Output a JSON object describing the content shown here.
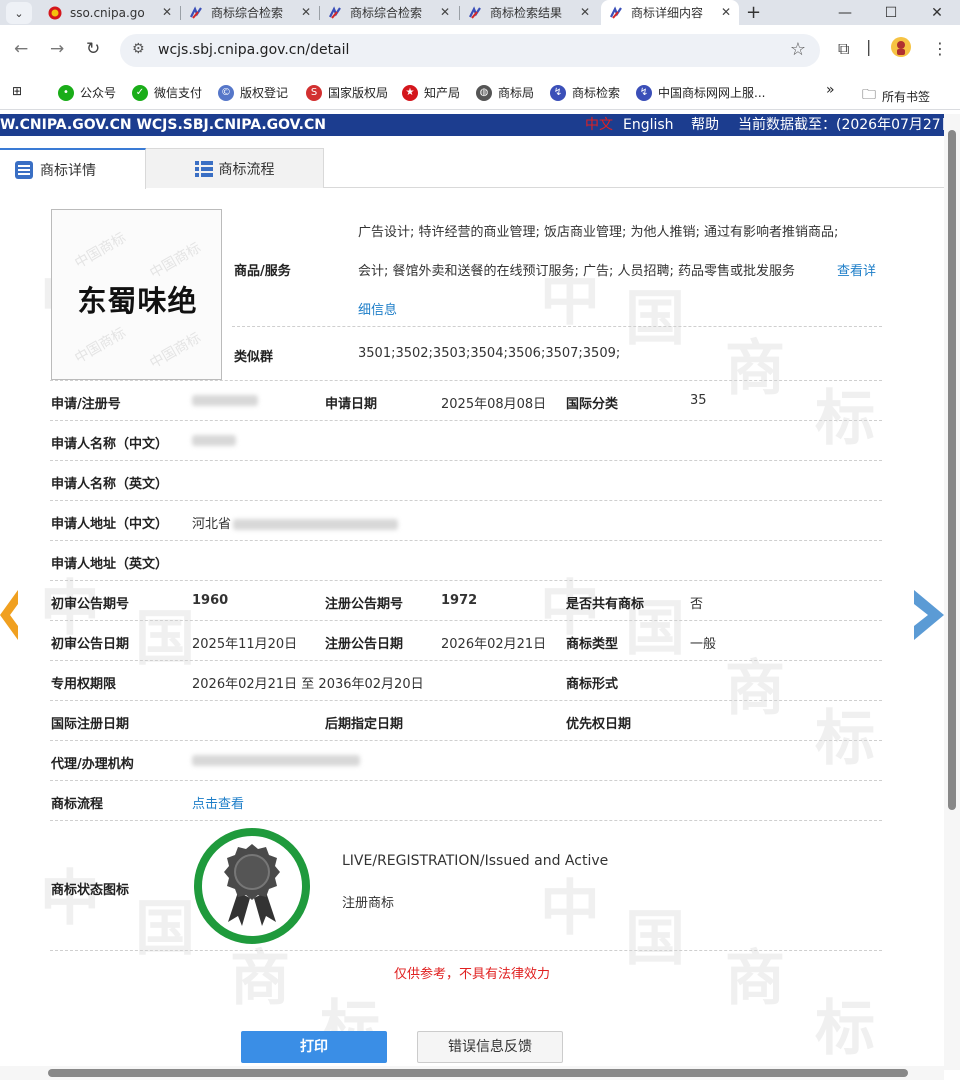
{
  "browser": {
    "tabs": [
      {
        "title": "sso.cnipa.go",
        "icon": "cnipa-emblem-icon"
      },
      {
        "title": "商标综合检索",
        "icon": "trademark-bureau-icon"
      },
      {
        "title": "商标综合检索",
        "icon": "trademark-bureau-icon"
      },
      {
        "title": "商标检索结果",
        "icon": "trademark-bureau-icon"
      },
      {
        "title": "商标详细内容",
        "icon": "trademark-bureau-icon",
        "active": true
      }
    ],
    "url": "wcjs.sbj.cnipa.gov.cn/detail",
    "bookmarks": [
      "公众号",
      "微信支付",
      "版权登记",
      "国家版权局",
      "知产局",
      "商标局",
      "商标检索",
      "中国商标网网上服..."
    ],
    "all_bookmarks": "所有书签",
    "overflow_glyph": "»"
  },
  "site_bar": {
    "site": "W.CNIPA.GOV.CN WCJS.SBJ.CNIPA.GOV.CN",
    "lang_cn": "中文",
    "lang_en": "English",
    "help": "帮助",
    "data_as_of": "当前数据截至：(2026年07月27日"
  },
  "page_tabs": {
    "detail": "商标详情",
    "flow": "商标流程"
  },
  "trademark": {
    "mark_text": "东蜀味绝",
    "goods_label": "商品/服务",
    "goods_lines": [
      "广告设计; 特许经营的商业管理; 饭店商业管理; 为他人推销; 通过有影响者推销商品;",
      "会计; 餐馆外卖和送餐的在线预订服务; 广告; 人员招聘; 药品零售或批发服务"
    ],
    "view_more": "查看详",
    "view_more_cont": "细信息",
    "similar_label": "类似群",
    "similar_value": "3501;3502;3503;3504;3506;3507;3509;"
  },
  "fields": {
    "reg_no_label": "申请/注册号",
    "app_date_label": "申请日期",
    "app_date": "2025年08月08日",
    "intl_class_label": "国际分类",
    "intl_class": "35",
    "applicant_cn_label": "申请人名称（中文）",
    "applicant_en_label": "申请人名称（英文）",
    "address_cn_label": "申请人地址（中文）",
    "address_cn_prefix": "河北省",
    "address_en_label": "申请人地址（英文）",
    "prelim_issue_label": "初审公告期号",
    "prelim_issue": "1960",
    "reg_issue_label": "注册公告期号",
    "reg_issue": "1972",
    "shared_label": "是否共有商标",
    "shared": "否",
    "prelim_date_label": "初审公告日期",
    "prelim_date": "2025年11月20日",
    "reg_date_label": "注册公告日期",
    "reg_date": "2026年02月21日",
    "type_label": "商标类型",
    "type": "一般",
    "term_label": "专用权期限",
    "term": "2026年02月21日 至 2036年02月20日",
    "form_label": "商标形式",
    "intl_reg_date_label": "国际注册日期",
    "later_date_label": "后期指定日期",
    "priority_date_label": "优先权日期",
    "agent_label": "代理/办理机构",
    "flow_label": "商标流程",
    "flow_link": "点击查看",
    "status_label": "商标状态图标",
    "status_en": "LIVE/REGISTRATION/Issued and Active",
    "status_cn": "注册商标"
  },
  "notice": "仅供参考，不具有法律效力",
  "buttons": {
    "print": "打印",
    "feedback": "错误信息反馈"
  },
  "colors": {
    "site_bar": "#1c3d8f",
    "link": "#1e7ec8",
    "notice": "#e02020",
    "print_button": "#3a8ee6",
    "status_ring": "#1f9a3c",
    "arrow_left": "#f0a020",
    "arrow_right": "#5b9bd5"
  }
}
